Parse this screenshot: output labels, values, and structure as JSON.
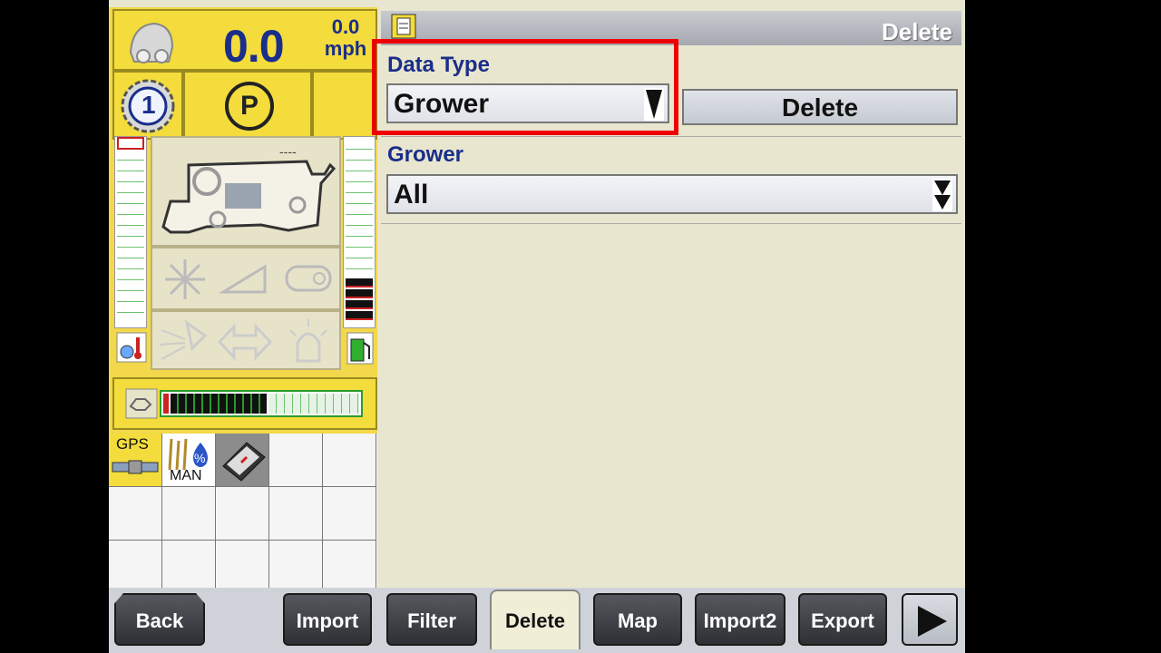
{
  "status": {
    "speed_value": "0.0",
    "speed_small": "0.0",
    "speed_unit": "mph",
    "gear_number": "1",
    "park_label": "P"
  },
  "grid": {
    "gps_label": "GPS",
    "man_label": "MAN"
  },
  "title": "Delete",
  "data_type": {
    "label": "Data Type",
    "value": "Grower"
  },
  "delete_button": "Delete",
  "grower": {
    "label": "Grower",
    "value": "All"
  },
  "tabs": [
    {
      "label": "Back"
    },
    {
      "label": "Import"
    },
    {
      "label": "Filter"
    },
    {
      "label": "Delete"
    },
    {
      "label": "Map"
    },
    {
      "label": "Import2"
    },
    {
      "label": "Export"
    }
  ],
  "colors": {
    "accent_yellow": "#f3dc3c",
    "label_blue": "#1a2e8a",
    "highlight_red": "#ee0000"
  }
}
